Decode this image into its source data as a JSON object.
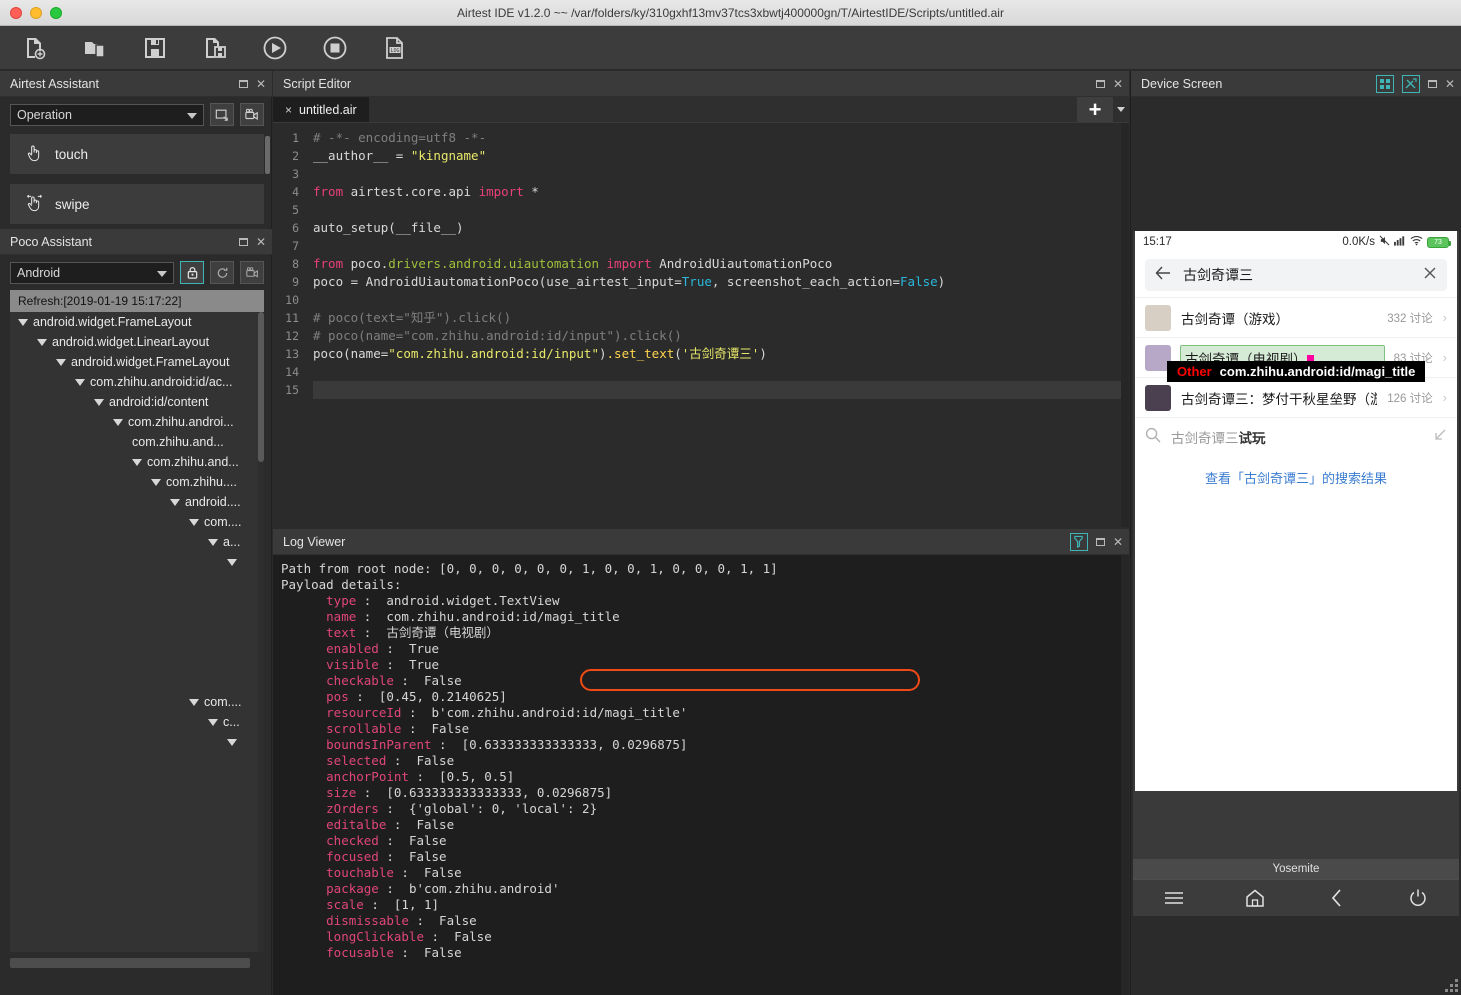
{
  "window": {
    "title": "Airtest IDE v1.2.0 ~~ /var/folders/ky/310gxhf13mv37tcs3xbwtj400000gn/T/AirtestIDE/Scripts/untitled.air"
  },
  "toolbar": {
    "buttons": [
      {
        "name": "new-script-icon",
        "label": "New Script"
      },
      {
        "name": "open-folder-icon",
        "label": "Open"
      },
      {
        "name": "save-icon",
        "label": "Save"
      },
      {
        "name": "save-as-icon",
        "label": "Save As"
      },
      {
        "name": "run-icon",
        "label": "Run"
      },
      {
        "name": "stop-icon",
        "label": "Stop"
      },
      {
        "name": "log-icon",
        "label": "LOG"
      }
    ]
  },
  "airtest_assistant": {
    "title": "Airtest Assistant",
    "mode_value": "Operation",
    "operations": [
      {
        "label": "touch",
        "icon": "touch-hand-icon"
      },
      {
        "label": "swipe",
        "icon": "swipe-hand-icon"
      }
    ]
  },
  "poco_assistant": {
    "title": "Poco Assistant",
    "platform_value": "Android",
    "refresh_label": "Refresh:[2019-01-19 15:17:22]",
    "tools": [
      {
        "name": "lock-icon",
        "active": true
      },
      {
        "name": "refresh-icon",
        "active": false
      },
      {
        "name": "camera-icon",
        "active": false
      }
    ],
    "tree": [
      {
        "label": "android.widget.FrameLayout",
        "depth": 0,
        "expander": true
      },
      {
        "label": "android.widget.LinearLayout",
        "depth": 1,
        "expander": true
      },
      {
        "label": "android.widget.FrameLayout",
        "depth": 2,
        "expander": true
      },
      {
        "label": "com.zhihu.android:id/ac...",
        "depth": 3,
        "expander": true
      },
      {
        "label": "android:id/content",
        "depth": 4,
        "expander": true
      },
      {
        "label": "com.zhihu.androi...",
        "depth": 5,
        "expander": true
      },
      {
        "label": "com.zhihu.and...",
        "depth": 6,
        "expander": false
      },
      {
        "label": "com.zhihu.and...",
        "depth": 6,
        "expander": true
      },
      {
        "label": "com.zhihu....",
        "depth": 7,
        "expander": true
      },
      {
        "label": "android....",
        "depth": 8,
        "expander": true
      },
      {
        "label": "com....",
        "depth": 9,
        "expander": true
      },
      {
        "label": "a...",
        "depth": 10,
        "expander": true
      },
      {
        "label": "",
        "depth": 11,
        "expander": true
      },
      {
        "label": "",
        "depth": 0,
        "expander": false
      },
      {
        "label": "",
        "depth": 0,
        "expander": false
      },
      {
        "label": "",
        "depth": 0,
        "expander": false
      },
      {
        "label": "",
        "depth": 0,
        "expander": false
      },
      {
        "label": "",
        "depth": 0,
        "expander": false
      },
      {
        "label": "",
        "depth": 0,
        "expander": false
      },
      {
        "label": "com....",
        "depth": 9,
        "expander": true
      },
      {
        "label": "c...",
        "depth": 10,
        "expander": true
      },
      {
        "label": "",
        "depth": 11,
        "expander": true
      }
    ]
  },
  "script_editor": {
    "title": "Script Editor",
    "tab_label": "untitled.air",
    "tab_close": "×",
    "add_tab_label": "+",
    "code_lines": [
      {
        "n": "1",
        "tokens": [
          {
            "t": "# -*- encoding=utf8 -*-",
            "c": "cm"
          }
        ]
      },
      {
        "n": "2",
        "tokens": [
          {
            "t": "__author__ = ",
            "c": "pl"
          },
          {
            "t": "\"kingname\"",
            "c": "str"
          }
        ]
      },
      {
        "n": "3",
        "tokens": []
      },
      {
        "n": "4",
        "tokens": [
          {
            "t": "from ",
            "c": "kw2"
          },
          {
            "t": "airtest.core.api ",
            "c": "pl"
          },
          {
            "t": "import ",
            "c": "kw2"
          },
          {
            "t": "*",
            "c": "pl"
          }
        ]
      },
      {
        "n": "5",
        "tokens": []
      },
      {
        "n": "6",
        "tokens": [
          {
            "t": "auto_setup(__file__)",
            "c": "pl"
          }
        ]
      },
      {
        "n": "7",
        "tokens": []
      },
      {
        "n": "8",
        "tokens": [
          {
            "t": "from ",
            "c": "kw2"
          },
          {
            "t": "poco.",
            "c": "pl"
          },
          {
            "t": "drivers.android.uiautomation ",
            "c": "mod"
          },
          {
            "t": "import ",
            "c": "kw2"
          },
          {
            "t": "AndroidUiautomationPoco",
            "c": "pl"
          }
        ]
      },
      {
        "n": "9",
        "tokens": [
          {
            "t": "poco = AndroidUiautomationPoco(use_airtest_input=",
            "c": "pl"
          },
          {
            "t": "True",
            "c": "num"
          },
          {
            "t": ", screenshot_each_action=",
            "c": "pl"
          },
          {
            "t": "False",
            "c": "num"
          },
          {
            "t": ")",
            "c": "pl"
          }
        ]
      },
      {
        "n": "10",
        "tokens": []
      },
      {
        "n": "11",
        "tokens": [
          {
            "t": "# poco(text=\"知乎\").click()",
            "c": "cm"
          }
        ]
      },
      {
        "n": "12",
        "tokens": [
          {
            "t": "# poco(name=\"com.zhihu.android:id/input\").click()",
            "c": "cm"
          }
        ]
      },
      {
        "n": "13",
        "tokens": [
          {
            "t": "poco(name=",
            "c": "pl"
          },
          {
            "t": "\"com.zhihu.android:id/input\"",
            "c": "str"
          },
          {
            "t": ")",
            "c": "pl"
          },
          {
            "t": ".set_text",
            "c": "fn"
          },
          {
            "t": "(",
            "c": "pl"
          },
          {
            "t": "'古剑奇谭三'",
            "c": "str"
          },
          {
            "t": ")",
            "c": "pl"
          }
        ]
      },
      {
        "n": "14",
        "tokens": []
      },
      {
        "n": "15",
        "tokens": [],
        "current": true
      }
    ]
  },
  "log_viewer": {
    "title": "Log Viewer",
    "filter_icon": "filter-funnel-icon",
    "lines": [
      {
        "raw": "Path from root node: [0, 0, 0, 0, 0, 0, 1, 0, 0, 1, 0, 0, 0, 1, 1]"
      },
      {
        "raw": "Payload details:"
      },
      {
        "key": "type",
        "value": "android.widget.TextView"
      },
      {
        "key": "name",
        "value": "com.zhihu.android:id/magi_title",
        "highlighted": true
      },
      {
        "key": "text",
        "value": "古剑奇谭（电视剧）"
      },
      {
        "key": "enabled",
        "value": "True"
      },
      {
        "key": "visible",
        "value": "True"
      },
      {
        "key": "checkable",
        "value": "False"
      },
      {
        "key": "pos",
        "value": "[0.45, 0.2140625]"
      },
      {
        "key": "resourceId",
        "value": "b'com.zhihu.android:id/magi_title'"
      },
      {
        "key": "scrollable",
        "value": "False"
      },
      {
        "key": "boundsInParent",
        "value": "[0.633333333333333, 0.0296875]"
      },
      {
        "key": "selected",
        "value": "False"
      },
      {
        "key": "anchorPoint",
        "value": "[0.5, 0.5]"
      },
      {
        "key": "size",
        "value": "[0.633333333333333, 0.0296875]"
      },
      {
        "key": "zOrders",
        "value": "{'global': 0, 'local': 2}"
      },
      {
        "key": "editalbe",
        "value": "False"
      },
      {
        "key": "checked",
        "value": "False"
      },
      {
        "key": "focused",
        "value": "False"
      },
      {
        "key": "touchable",
        "value": "False"
      },
      {
        "key": "package",
        "value": "b'com.zhihu.android'"
      },
      {
        "key": "scale",
        "value": "[1, 1]"
      },
      {
        "key": "dismissable",
        "value": "False"
      },
      {
        "key": "longClickable",
        "value": "False"
      },
      {
        "key": "focusable",
        "value": "False"
      }
    ]
  },
  "device_screen": {
    "title": "Device Screen",
    "header_icons": [
      {
        "name": "grid-layout-icon"
      },
      {
        "name": "tools-icon"
      }
    ],
    "device_name": "Yosemite",
    "status_bar": {
      "time": "15:17",
      "network_speed": "0.0K/s",
      "battery_level": "73"
    },
    "search": {
      "query": "古剑奇谭三",
      "back_icon": "back-arrow-icon",
      "clear_icon": "clear-x-icon"
    },
    "results": [
      {
        "title": "古剑奇谭（游戏）",
        "count": "332 讨论",
        "thumb_color": "#d8cfc4",
        "selected": false
      },
      {
        "title": "古剑奇谭（电视剧）",
        "count": "83 讨论",
        "thumb_color": "#b8a8c8",
        "selected": true
      },
      {
        "title": "古剑奇谭三：梦付干秋星垒野（游...",
        "count": "126 讨论",
        "thumb_color": "#4a4050",
        "selected": false
      }
    ],
    "suggestion": {
      "prefix": "古剑奇谭三",
      "bold": "试玩",
      "search_icon": "search-icon",
      "arrow_icon": "arrow-up-left-icon"
    },
    "view_all": "查看「古剑奇谭三」的搜索结果",
    "poco_tooltip": {
      "label": "Other",
      "value": "com.zhihu.android:id/magi_title"
    },
    "nav_buttons": [
      {
        "name": "menu-icon"
      },
      {
        "name": "home-icon"
      },
      {
        "name": "back-icon"
      },
      {
        "name": "power-icon"
      }
    ]
  },
  "colors": {
    "accent_teal": "#3fb5b5",
    "highlight_orange": "#f04a16",
    "link_blue": "#3a7cd0",
    "tooltip_red": "#ff0000"
  }
}
